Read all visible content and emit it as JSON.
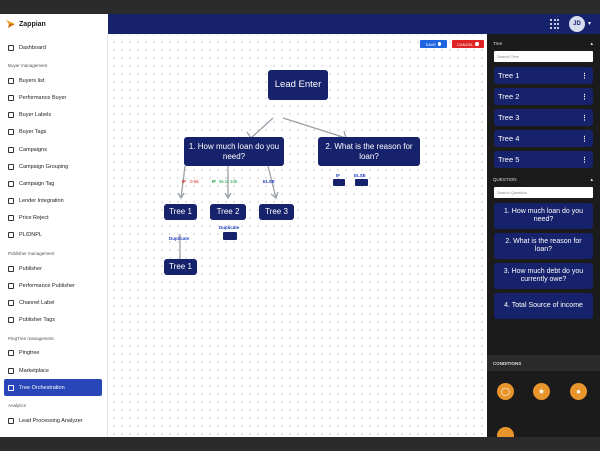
{
  "app": {
    "brand": "Zappian",
    "user_initials": "JD"
  },
  "sidebar": {
    "sections": [
      {
        "title": "",
        "items": [
          {
            "label": "Dashboard",
            "icon": "dashboard-icon"
          }
        ]
      },
      {
        "title": "Buyer management",
        "items": [
          {
            "label": "Buyers list",
            "icon": "list-icon"
          },
          {
            "label": "Performance Buyer",
            "icon": "chart-icon"
          },
          {
            "label": "Buyer Labels",
            "icon": "label-icon"
          },
          {
            "label": "Buyer Tags",
            "icon": "tag-icon"
          },
          {
            "label": "Campaigns",
            "icon": "megaphone-icon"
          },
          {
            "label": "Campaign Grouping",
            "icon": "group-icon"
          },
          {
            "label": "Campaign Tag",
            "icon": "tag-icon"
          },
          {
            "label": "Lender Integration",
            "icon": "integration-icon"
          },
          {
            "label": "Price Reject",
            "icon": "price-icon"
          },
          {
            "label": "PL/DNPL",
            "icon": "block-icon"
          }
        ]
      },
      {
        "title": "Publisher management",
        "items": [
          {
            "label": "Publisher",
            "icon": "publisher-icon"
          },
          {
            "label": "Performance Publisher",
            "icon": "chart-icon"
          },
          {
            "label": "Channel Label",
            "icon": "channel-icon"
          },
          {
            "label": "Publisher Tags",
            "icon": "tag-icon"
          }
        ]
      },
      {
        "title": "PingTree management",
        "items": [
          {
            "label": "Pingtree",
            "icon": "tree-icon"
          },
          {
            "label": "Marketplace",
            "icon": "store-icon"
          },
          {
            "label": "Tree Orchestration",
            "icon": "tree-icon",
            "active": true
          }
        ]
      },
      {
        "title": "Analytics",
        "items": [
          {
            "label": "Lead Processing Analyzer",
            "icon": "analyzer-icon"
          }
        ]
      }
    ]
  },
  "toolbar": {
    "save_label": "SAVE",
    "cancel_label": "CANCEL"
  },
  "canvas": {
    "lead_node": "Lead Enter",
    "q1_node": "1. How much loan do you need?",
    "q2_node": "2. What is the reason for loan?",
    "tree1_label": "Tree 1",
    "tree2_label": "Tree 2",
    "tree3_label": "Tree 3",
    "tree1b_label": "Tree 1",
    "if_label_1": "IF",
    "range_1": "0-5k",
    "if_label_2": "IF",
    "range_2": "5k to 10k",
    "else_label_1": "ELSE",
    "if_label_3": "IF",
    "else_label_2": "ELSE",
    "duplicate_1": "Duplicate",
    "duplicate_2": "Duplicate",
    "colors": {
      "node": "#16226b",
      "range_red": "#e02424",
      "range_green": "#1e9e3a",
      "label_blue": "#1f3fbf"
    }
  },
  "right_panel": {
    "tree_header": "Tree",
    "tree_search_placeholder": "Search Tree",
    "trees": [
      "Tree 1",
      "Tree 2",
      "Tree 3",
      "Tree 4",
      "Tree 5"
    ],
    "question_header": "QUESTION",
    "question_search_placeholder": "Search Question",
    "questions": [
      "1. How much loan do you need?",
      "2. What is the reason for loan?",
      "3. How much debt do you currently owe?",
      "4. Total Source of income"
    ],
    "conditions_header": "CONDITIONS",
    "condition_icons": [
      "circle-icon",
      "star-icon",
      "user-icon"
    ],
    "accent": "#e8952b"
  }
}
